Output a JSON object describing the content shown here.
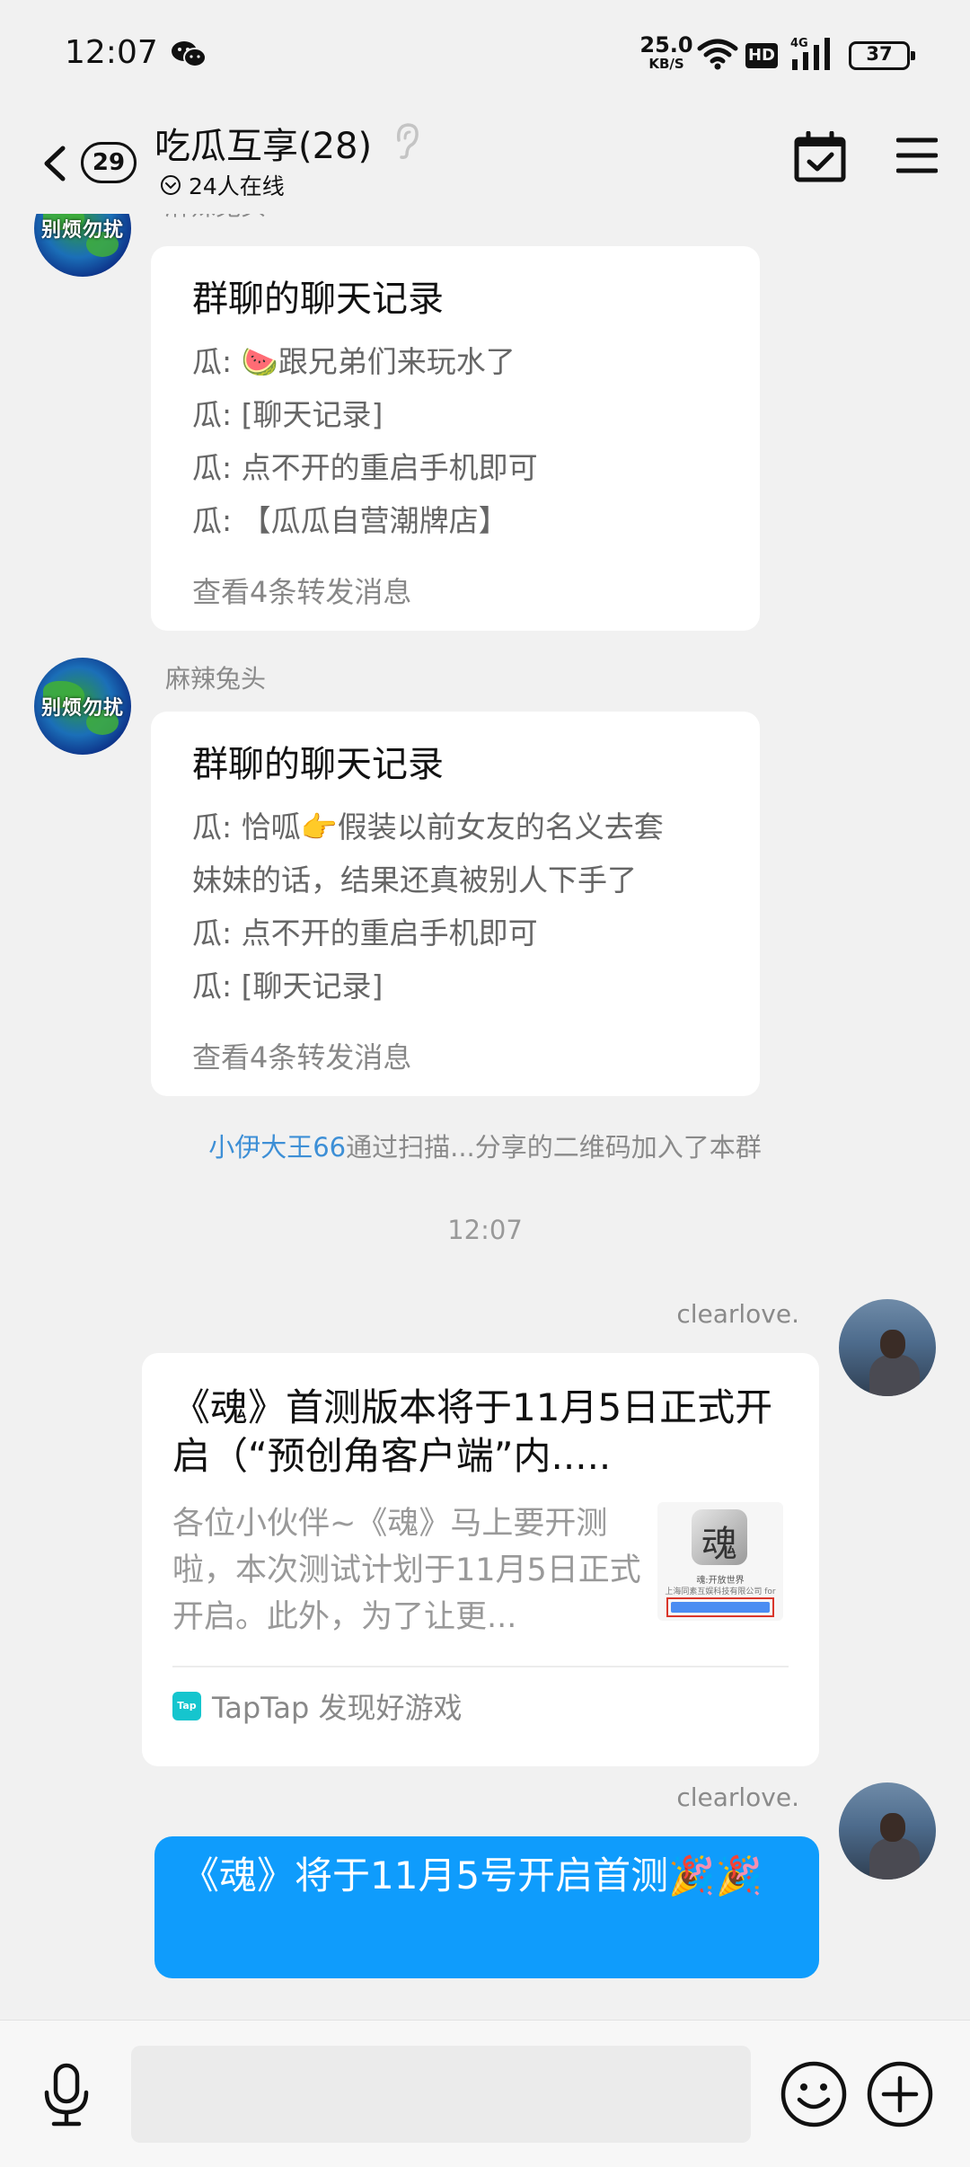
{
  "status_bar": {
    "time": "12:07",
    "net_speed": "25.0",
    "net_unit": "KB/S",
    "hd": "HD",
    "signal_label": "4G",
    "battery": "37"
  },
  "header": {
    "unread_count": "29",
    "group_title": "吃瓜互享(28)",
    "online_text": "24人在线"
  },
  "messages": {
    "first_sender_partial": "麻辣兔头",
    "forward1": {
      "title": "群聊的聊天记录",
      "lines": [
        "瓜: 🍉跟兄弟们来玩水了",
        "瓜: [聊天记录]",
        "瓜: 点不开的重启手机即可",
        "瓜: 【瓜瓜自营潮牌店】"
      ],
      "footer": "查看4条转发消息"
    },
    "sender2": "麻辣兔头",
    "avatar_text": "别烦勿扰",
    "forward2": {
      "title": "群聊的聊天记录",
      "lines": [
        "瓜: 恰呱👉假装以前女友的名义去套",
        "妹妹的话，结果还真被别人下手了",
        "瓜: 点不开的重启手机即可",
        "瓜: [聊天记录]"
      ],
      "footer": "查看4条转发消息"
    },
    "system": {
      "user_link": "小伊大王66",
      "text": "通过扫描...分享的二维码加入了本群"
    },
    "time_divider": "12:07",
    "self_name_1": "clearlove.",
    "share_card": {
      "title": "《魂》首测版本将于11月5日正式开启（“预创角客户端”内.....",
      "desc": "各位小伙伴~《魂》马上要开测啦，本次测试计划于11月5日正式开启。此外，为了让更...",
      "thumb_glyph": "魂",
      "thumb_cap1": "魂:开放世界",
      "thumb_cap2": "上海同素互娱科技有限公司 for",
      "source": "TapTap 发现好游戏",
      "source_icon_text": "Tap"
    },
    "self_name_2": "clearlove.",
    "blue_bubble": "《魂》将于11月5号开启首测🎉🎉"
  },
  "input_bar": {
    "placeholder": ""
  }
}
